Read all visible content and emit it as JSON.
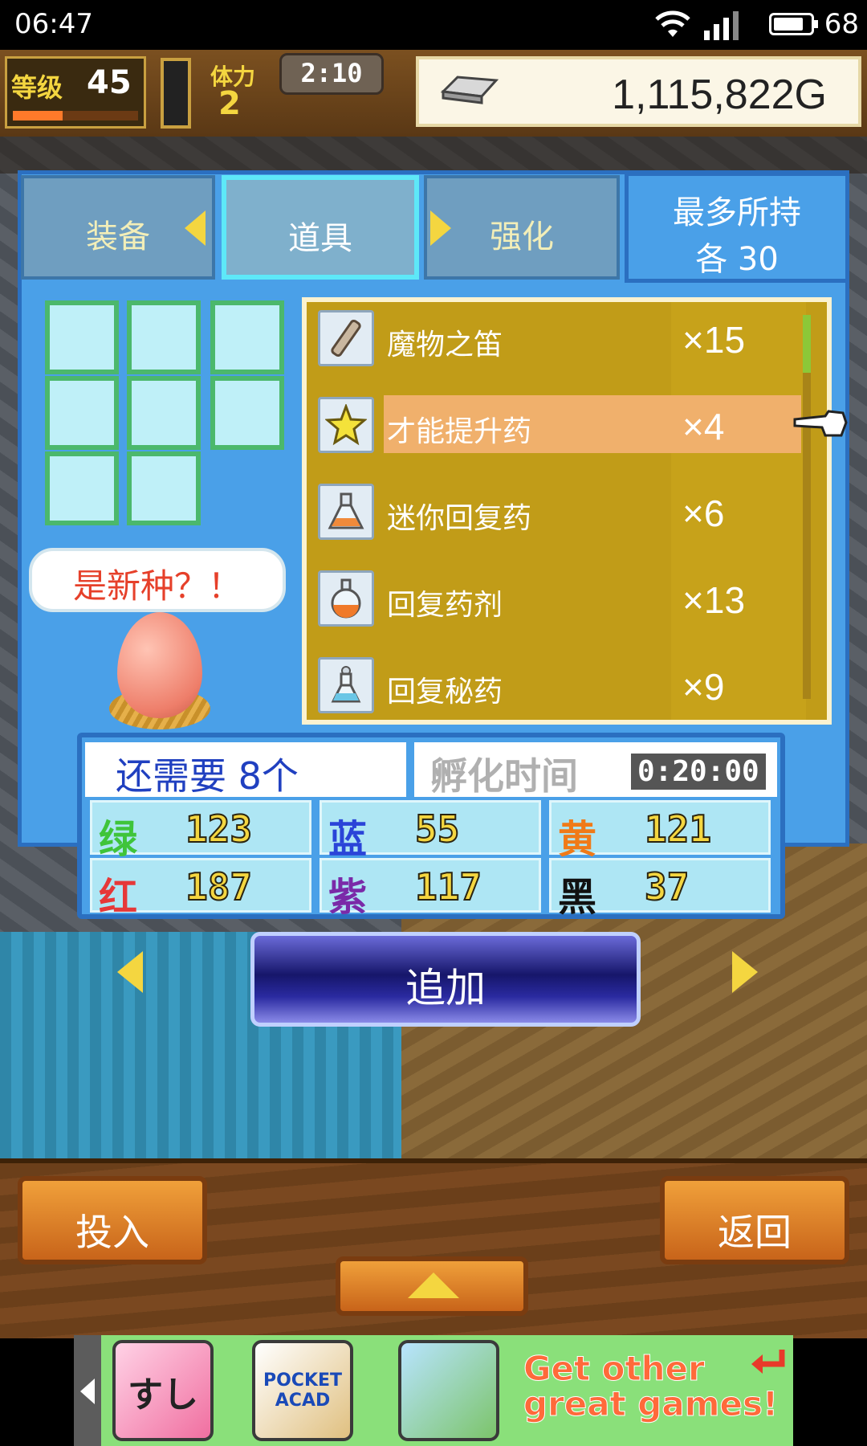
{
  "status_bar": {
    "time": "06:47",
    "battery": "68",
    "network": "4G"
  },
  "hud": {
    "level_label": "等级",
    "level_value": "45",
    "level_exp_fraction": 0.4,
    "stamina_label": "体力",
    "stamina_value": "2",
    "timer": "2:10",
    "money": "1,115,822G"
  },
  "tabs": [
    {
      "label": "装备"
    },
    {
      "label": "道具"
    },
    {
      "label": "强化"
    }
  ],
  "max_hold": {
    "title": "最多所持",
    "value": "各  30"
  },
  "bubble_text": "是新种？！",
  "items": [
    {
      "name": "魔物之笛",
      "count": "×15",
      "icon": "flute-icon"
    },
    {
      "name": "才能提升药",
      "count": "×4",
      "icon": "star-icon"
    },
    {
      "name": "迷你回复药",
      "count": "×6",
      "icon": "potion-icon"
    },
    {
      "name": "回复药剂",
      "count": "×13",
      "icon": "potion-icon"
    },
    {
      "name": "回复秘药",
      "count": "×9",
      "icon": "potion-icon"
    }
  ],
  "requirement": {
    "need_text": "还需要 8个",
    "hatch_label": "孵化时间",
    "hatch_time": "0:20:00"
  },
  "colors": [
    {
      "name": "绿",
      "value": "123",
      "color": "#3fc43a"
    },
    {
      "name": "蓝",
      "value": "55",
      "color": "#2a44d8"
    },
    {
      "name": "黄",
      "value": "121",
      "color": "#f07a18"
    },
    {
      "name": "红",
      "value": "187",
      "color": "#e63838"
    },
    {
      "name": "紫",
      "value": "117",
      "color": "#7a2aa8"
    },
    {
      "name": "黑",
      "value": "37",
      "color": "#111111"
    }
  ],
  "buttons": {
    "add": "追加",
    "put": "投入",
    "back": "返回"
  },
  "ad": {
    "game1": "すし",
    "game2": "POCKET ACAD",
    "game3": "",
    "cta": "Get other great games!"
  }
}
